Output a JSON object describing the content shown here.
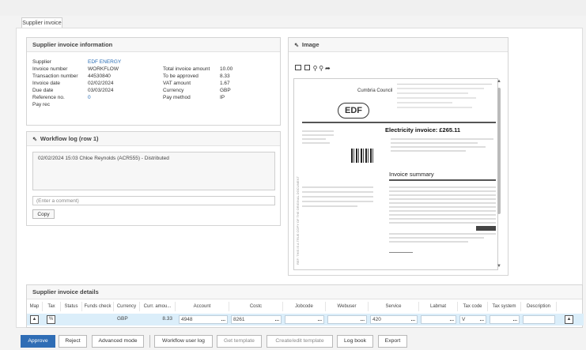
{
  "tab": {
    "label": "Supplier invoice"
  },
  "info": {
    "title": "Supplier invoice information",
    "left": [
      {
        "label": "Supplier",
        "value": "EDF ENERGY"
      },
      {
        "label": "Invoice number",
        "value": "WORKFLOW"
      },
      {
        "label": "Transaction number",
        "value": "44530840"
      },
      {
        "label": "Invoice date",
        "value": "02/02/2024"
      },
      {
        "label": "Due date",
        "value": "03/03/2024"
      },
      {
        "label": "Reference no.",
        "value": "0"
      },
      {
        "label": "Pay rec",
        "value": ""
      }
    ],
    "right": [
      {
        "label": "Total invoice amount",
        "value": "10.00"
      },
      {
        "label": "To be approved",
        "value": "8.33"
      },
      {
        "label": "VAT amount",
        "value": "1.67"
      },
      {
        "label": "Currency",
        "value": "GBP"
      },
      {
        "label": "Pay method",
        "value": "IP"
      }
    ]
  },
  "workflow": {
    "title": "Workflow log (row 1)",
    "entry": "02/02/2024 15:03 Chloe Reynolds (ACR555) - Distributed",
    "comment_placeholder": "(Enter a comment)",
    "copy_label": "Copy"
  },
  "image": {
    "title": "Image",
    "doc": {
      "company": "Cumbria Council",
      "logo": "EDF",
      "heading": "Electricity invoice: £265.11",
      "summary_title": "Invoice summary",
      "side_text": "REF: THIS IS A TRUE COPY OF THE ORIGINAL DOCUMENT"
    }
  },
  "details": {
    "title": "Supplier invoice details",
    "columns": [
      "Map",
      "Tax",
      "Status",
      "Funds check",
      "Currency",
      "Curr. amou...",
      "Account",
      "Costc",
      "Jobcode",
      "Webuser",
      "Service",
      "Labmat",
      "Tax code",
      "Tax system",
      "Description"
    ],
    "row": {
      "currency": "GBP",
      "amount": "8.33",
      "account": "4948",
      "costc": "8261",
      "jobcode": "",
      "webuser": "",
      "service": "420",
      "labmat": "",
      "taxcode": "V",
      "taxsystem": "",
      "description": ""
    }
  },
  "buttons": {
    "approve": "Approve",
    "reject": "Reject",
    "advanced": "Advanced mode",
    "workflow_log": "Workflow user log",
    "get_template": "Get template",
    "create_template": "Create/edit template",
    "log_book": "Log book",
    "export": "Export"
  },
  "colors": {
    "primary": "#2f6db5",
    "link": "#2a6db5",
    "row_highlight": "#dbeefa"
  }
}
